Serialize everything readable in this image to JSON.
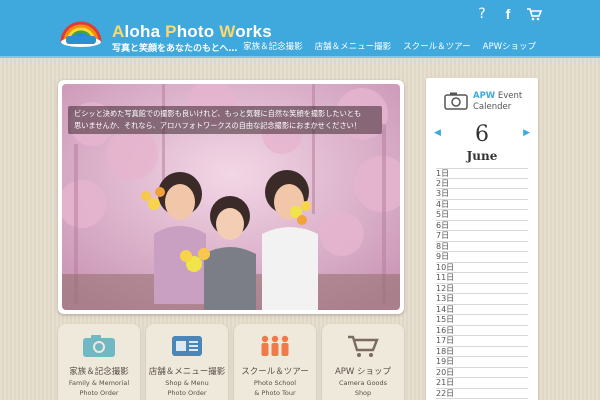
{
  "header": {
    "brand_a": "A",
    "brand_loha": "loha ",
    "brand_p": "P",
    "brand_hoto": "hoto ",
    "brand_w": "W",
    "brand_orks": "orks",
    "tagline": "写真と笑顔をあなたのもとへ…",
    "icons": [
      "help-icon",
      "facebook-icon",
      "cart-icon"
    ],
    "help_glyph": "?",
    "fb_glyph": "f",
    "nav": [
      "家族＆記念撮影",
      "店舗＆メニュー撮影",
      "スクール＆ツアー",
      "APWショップ"
    ],
    "colors": {
      "header": "#3fa9dd",
      "accent": "#ffd86b"
    }
  },
  "hero": {
    "caption_line1": "ビシッと決めた写真館での撮影も良いけれど、もっと気軽に自然な笑顔を撮影したいとも",
    "caption_line2": "思いませんか、それなら、アロハフォトワークスの自由な記念撮影におまかせください！"
  },
  "cards": [
    {
      "title": "家族＆記念撮影",
      "sub1": "Family & Memorial",
      "sub2": "Photo Order"
    },
    {
      "title": "店舗＆メニュー撮影",
      "sub1": "Shop & Menu",
      "sub2": "Photo Order"
    },
    {
      "title": "スクール＆ツアー",
      "sub1": "Photo School",
      "sub2": "& Photo Tour"
    },
    {
      "title": "APW ショップ",
      "sub1": "Camera Goods",
      "sub2": "Shop"
    }
  ],
  "calendar": {
    "title_apw": "APW",
    "title_event": " Event",
    "title_line2": "Calender",
    "day": "6",
    "month": "June",
    "prev_glyph": "◀",
    "next_glyph": "▶",
    "rows": [
      "1日",
      "2日",
      "3日",
      "4日",
      "5日",
      "6日",
      "7日",
      "8日",
      "9日",
      "10日",
      "11日",
      "12日",
      "13日",
      "14日",
      "15日",
      "16日",
      "17日",
      "18日",
      "19日",
      "20日",
      "21日",
      "22日"
    ]
  }
}
